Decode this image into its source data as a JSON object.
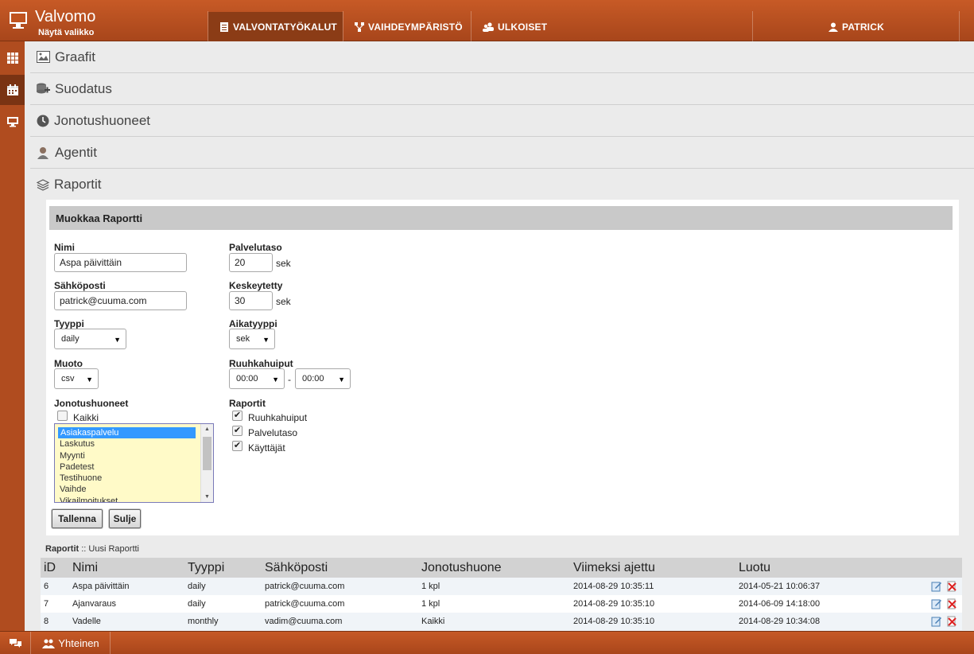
{
  "header": {
    "title": "Valvomo",
    "subtitle": "Näytä valikko",
    "nav": [
      {
        "label": "VALVONTATYÖKALUT",
        "icon": "document-icon"
      },
      {
        "label": "VAIHDEYMPÄRISTÖ",
        "icon": "network-icon"
      },
      {
        "label": "ULKOISET",
        "icon": "users-icon"
      }
    ],
    "user": "PATRICK"
  },
  "sidebar": {
    "items": [
      {
        "icon": "grid-icon"
      },
      {
        "icon": "calendar-icon"
      },
      {
        "icon": "monitor-icon"
      }
    ]
  },
  "panels": [
    {
      "label": "Graafit",
      "icon": "image-icon"
    },
    {
      "label": "Suodatus",
      "icon": "filter-icon"
    },
    {
      "label": "Jonotushuoneet",
      "icon": "clock-icon"
    },
    {
      "label": "Agentit",
      "icon": "agent-icon"
    },
    {
      "label": "Raportit",
      "icon": "layers-icon"
    }
  ],
  "form": {
    "title": "Muokkaa Raportti",
    "name_label": "Nimi",
    "name_value": "Aspa päivittäin",
    "email_label": "Sähköposti",
    "email_value": "patrick@cuuma.com",
    "type_label": "Tyyppi",
    "type_value": "daily",
    "format_label": "Muoto",
    "format_value": "csv",
    "queues_label": "Jonotushuoneet",
    "all_label": "Kaikki",
    "queues": [
      "Asiakaspalvelu",
      "Laskutus",
      "Myynti",
      "Padetest",
      "Testihuone",
      "Vaihde",
      "Vikailmoitukset"
    ],
    "service_label": "Palvelutaso",
    "service_value": "20",
    "service_unit": "sek",
    "aborted_label": "Keskeytetty",
    "aborted_value": "30",
    "aborted_unit": "sek",
    "timetype_label": "Aikatyyppi",
    "timetype_value": "sek",
    "peak_label": "Ruuhkahuiput",
    "peak_from": "00:00",
    "peak_sep": "-",
    "peak_to": "00:00",
    "reports_label": "Raportit",
    "reports": [
      "Ruuhkahuiput",
      "Palvelutaso",
      "Käyttäjät"
    ],
    "save_label": "Tallenna",
    "close_label": "Sulje"
  },
  "breadcrumb": {
    "section": "Raportit",
    "sep": "::",
    "action": "Uusi Raportti"
  },
  "table": {
    "headers": [
      "iD",
      "Nimi",
      "Tyyppi",
      "Sähköposti",
      "Jonotushuone",
      "Viimeksi ajettu",
      "Luotu"
    ],
    "rows": [
      [
        "6",
        "Aspa päivittäin",
        "daily",
        "patrick@cuuma.com",
        "1 kpl",
        "2014-08-29 10:35:11",
        "2014-05-21 10:06:37"
      ],
      [
        "7",
        "Ajanvaraus",
        "daily",
        "patrick@cuuma.com",
        "1 kpl",
        "2014-08-29 10:35:10",
        "2014-06-09 14:18:00"
      ],
      [
        "8",
        "Vadelle",
        "monthly",
        "vadim@cuuma.com",
        "Kaikki",
        "2014-08-29 10:35:10",
        "2014-08-29 10:34:08"
      ]
    ]
  },
  "footer": {
    "group_label": "Yhteinen"
  }
}
